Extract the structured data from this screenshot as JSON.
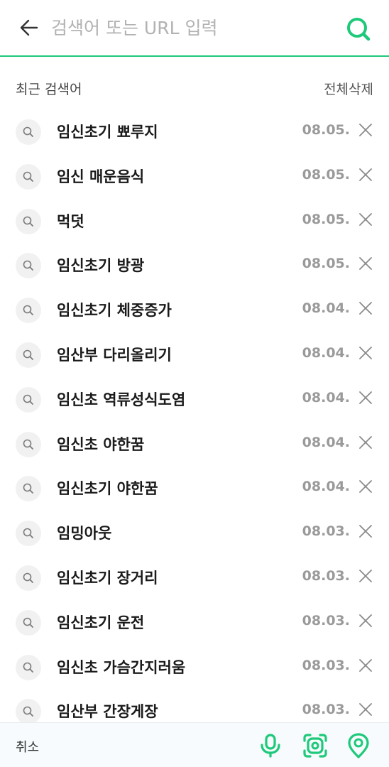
{
  "search": {
    "placeholder": "검색어 또는 URL 입력",
    "value": ""
  },
  "recent": {
    "title": "최근 검색어",
    "delete_all_label": "전체삭제",
    "items": [
      {
        "text": "임신초기 뾰루지",
        "date": "08.05."
      },
      {
        "text": "임신 매운음식",
        "date": "08.05."
      },
      {
        "text": "먹덧",
        "date": "08.05."
      },
      {
        "text": "임신초기 방광",
        "date": "08.05."
      },
      {
        "text": "임신초기 체중증가",
        "date": "08.04."
      },
      {
        "text": "임산부 다리올리기",
        "date": "08.04."
      },
      {
        "text": "임신초 역류성식도염",
        "date": "08.04."
      },
      {
        "text": "임신초 야한꿈",
        "date": "08.04."
      },
      {
        "text": "임신초기 야한꿈",
        "date": "08.04."
      },
      {
        "text": "임밍아웃",
        "date": "08.03."
      },
      {
        "text": "임신초기 장거리",
        "date": "08.03."
      },
      {
        "text": "임신초기 운전",
        "date": "08.03."
      },
      {
        "text": "임신초 가슴간지러움",
        "date": "08.03."
      },
      {
        "text": "임산부 간장게장",
        "date": "08.03."
      }
    ]
  },
  "bottom_bar": {
    "cancel_label": "취소"
  },
  "icons": {
    "back": "arrow-left-icon",
    "search": "search-icon",
    "history_item": "search-icon",
    "delete": "close-icon",
    "voice": "microphone-icon",
    "lens": "camera-lens-icon",
    "location": "location-pin-icon"
  },
  "colors": {
    "accent": "#1ec97a",
    "date_text": "#9a9a9a",
    "item_text": "#1a1a1a",
    "bottom_bar_bg": "#f7fbfd"
  }
}
